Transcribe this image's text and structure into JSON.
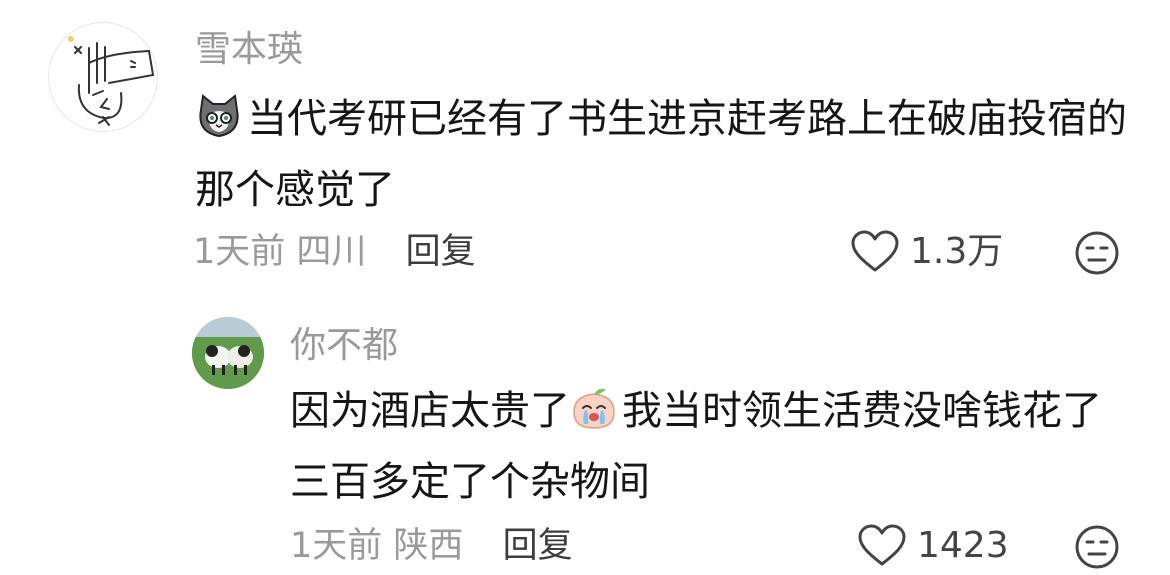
{
  "comments": [
    {
      "username": "雪本瑛",
      "emoji_icon": "grey-cat-emoji-icon",
      "text": "当代考研已经有了书生进京赶考路上在破庙投宿的那个感觉了",
      "time": "1天前",
      "location": "四川",
      "reply_label": "回复",
      "like_count": "1.3万",
      "dislike_icon": "meh-face-icon"
    },
    {
      "username": "你不都",
      "text_before_emoji": "因为酒店太贵了",
      "emoji_icon": "crying-peach-emoji-icon",
      "text_after_emoji": "我当时领生活费没啥钱花了三百多定了个杂物间",
      "time": "1天前",
      "location": "陕西",
      "reply_label": "回复",
      "like_count": "1423",
      "dislike_icon": "meh-face-icon"
    }
  ],
  "colors": {
    "meta_grey": "#9a9a9a",
    "body_text": "#161616",
    "reply_dark": "#3d3d3d"
  }
}
